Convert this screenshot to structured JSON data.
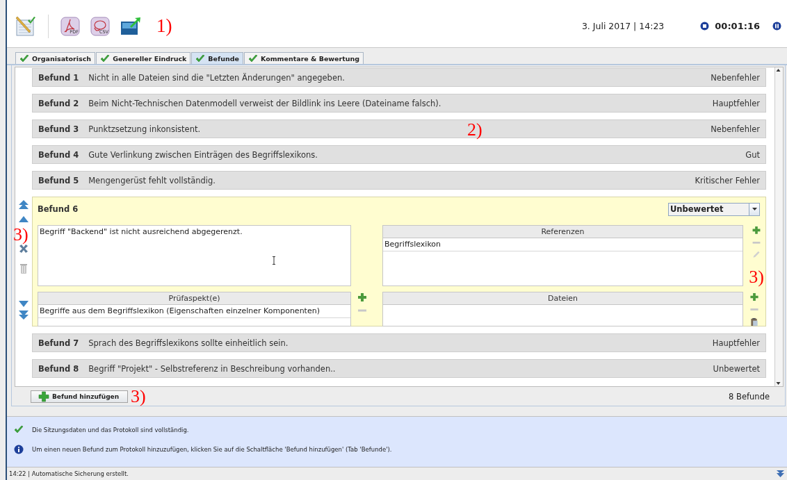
{
  "toolbar": {
    "tools": [
      {
        "kind": "protocol"
      },
      {
        "kind": "separator"
      },
      {
        "kind": "pdf",
        "label": "PDF"
      },
      {
        "kind": "csv",
        "label": "CSV"
      },
      {
        "kind": "export"
      }
    ],
    "annotation": "1)",
    "date": "3. Juli 2017 | 14:23",
    "timer": "00:01:16"
  },
  "tabs": [
    {
      "label": "Organisatorisch",
      "selected": false,
      "complete": true
    },
    {
      "label": "Genereller Eindruck",
      "selected": false,
      "complete": true
    },
    {
      "label": "Befunde",
      "selected": true,
      "complete": true
    },
    {
      "label": "Kommentare & Bewertung",
      "selected": false,
      "complete": true
    }
  ],
  "list_annotation": "2)",
  "findings": [
    {
      "number": "Befund 1",
      "text": "Nicht in alle Dateien sind die \"Letzten Änderungen\" angegeben.",
      "rating": "Nebenfehler",
      "expanded": false
    },
    {
      "number": "Befund 2",
      "text": "Beim Nicht-Technischen Datenmodell verweist der Bildlink ins Leere (Dateiname falsch).",
      "rating": "Hauptfehler",
      "expanded": false
    },
    {
      "number": "Befund 3",
      "text": "Punktzsetzung inkonsistent.",
      "rating": "Nebenfehler",
      "expanded": false
    },
    {
      "number": "Befund 4",
      "text": "Gute Verlinkung zwischen Einträgen des Begriffslexikons.",
      "rating": "Gut",
      "expanded": false
    },
    {
      "number": "Befund 5",
      "text": "Mengengerüst fehlt vollständig.",
      "rating": "Kritischer Fehler",
      "expanded": false
    },
    {
      "number": "Befund 6",
      "text": "Begriff \"Backend\" ist nicht ausreichend abgegerenzt.",
      "rating": "Unbewertet",
      "expanded": true,
      "gutter_tools": [
        {
          "kind": "move_top",
          "disabled": false
        },
        {
          "kind": "move_up",
          "disabled": false
        },
        {
          "kind": "delete",
          "disabled": false
        },
        {
          "kind": "discard",
          "disabled": true
        },
        {
          "kind": "move_down",
          "disabled": false
        },
        {
          "kind": "move_bottom",
          "disabled": false
        }
      ],
      "gutter_annotation": "3)",
      "references": {
        "header": "Referenzen",
        "rows": [
          "Begriffslexikon"
        ],
        "tools": [
          {
            "kind": "add",
            "disabled": false
          },
          {
            "kind": "remove",
            "disabled": true
          },
          {
            "kind": "edit",
            "disabled": true
          }
        ],
        "annotation": "3)"
      },
      "aspects": {
        "header": "Prüfaspekt(e)",
        "rows": [
          "Begriffe aus dem Begriffslexikon (Eigenschaften einzelner Komponenten)"
        ],
        "tools": [
          {
            "kind": "add",
            "disabled": false
          },
          {
            "kind": "remove",
            "disabled": true
          }
        ]
      },
      "files": {
        "header": "Dateien",
        "tools": [
          {
            "kind": "add",
            "disabled": false
          },
          {
            "kind": "remove",
            "disabled": true
          },
          {
            "kind": "paste",
            "disabled": false
          }
        ]
      }
    },
    {
      "number": "Befund 7",
      "text": "Sprach des Begriffslexikons sollte einheitlich sein.",
      "rating": "Hauptfehler",
      "expanded": false
    },
    {
      "number": "Befund 8",
      "text": "Begriff \"Projekt\" - Selbstreferenz in Beschreibung vorhanden..",
      "rating": "Unbewertet",
      "expanded": false
    }
  ],
  "add_button": {
    "label": "Befund hinzufügen",
    "annotation": "3)"
  },
  "count": "8 Befunde",
  "messages": [
    {
      "kind": "success",
      "text": "Die Sitzungsdaten und das Protokoll sind vollständig."
    },
    {
      "kind": "info",
      "text": "Um einen neuen Befund zum Protokoll hinzuzufügen, klicken Sie auf die Schaltfläche 'Befund hinzufügen' (Tab 'Befunde')."
    }
  ],
  "status": "14:22 | Automatische Sicherung erstellt."
}
